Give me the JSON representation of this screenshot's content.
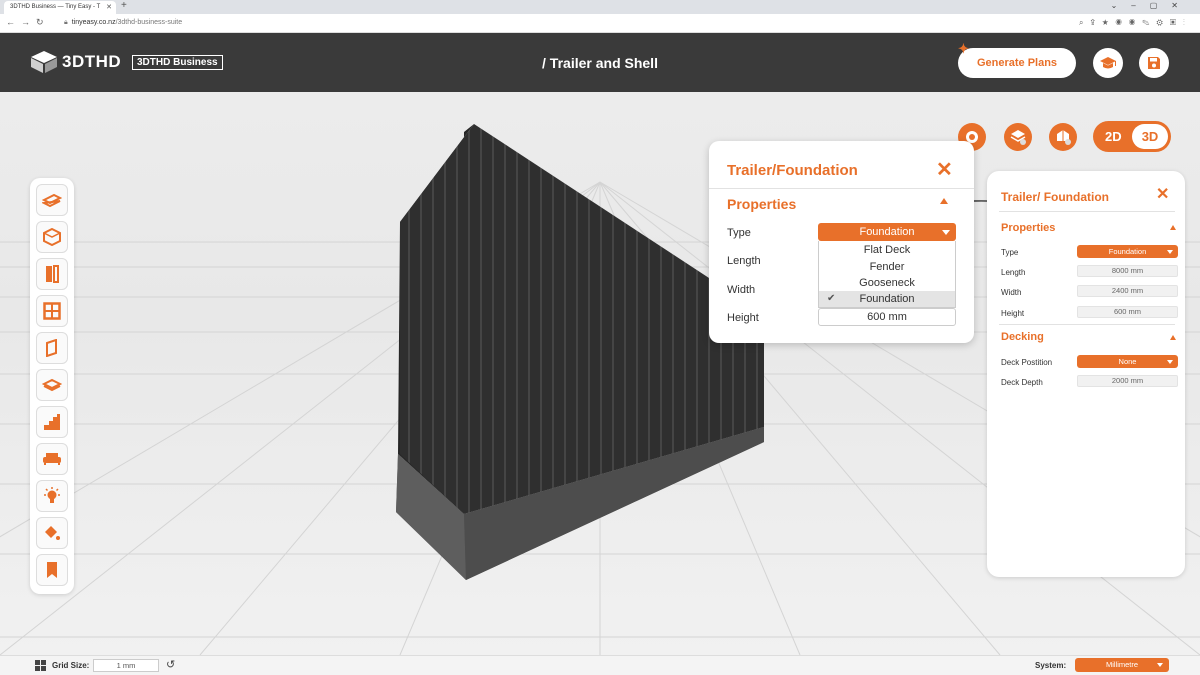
{
  "browser": {
    "tab_title": "3DTHD Business — Tiny Easy - T",
    "url_domain": "tinyeasy.co.nz",
    "url_path": "/3dthd-business-suite"
  },
  "header": {
    "logo_text": "3DTHD",
    "business_badge": "3DTHD Business",
    "page_title": "/ Trailer and Shell",
    "generate_label": "Generate Plans"
  },
  "view": {
    "label_2d": "2D",
    "label_3d": "3D",
    "active": "3D"
  },
  "popup": {
    "title": "Trailer/Foundation",
    "section": "Properties",
    "labels": {
      "type": "Type",
      "length": "Length",
      "width": "Width",
      "height": "Height"
    },
    "type_value": "Foundation",
    "type_options": [
      "Flat Deck",
      "Fender",
      "Gooseneck",
      "Foundation"
    ],
    "selected_option": "Foundation",
    "height_value": "600 mm"
  },
  "panel": {
    "title": "Trailer/ Foundation",
    "properties": {
      "section": "Properties",
      "type_label": "Type",
      "type_value": "Foundation",
      "length_label": "Length",
      "length_value": "8000 mm",
      "width_label": "Width",
      "width_value": "2400 mm",
      "height_label": "Height",
      "height_value": "600 mm"
    },
    "decking": {
      "section": "Decking",
      "position_label": "Deck Postition",
      "position_value": "None",
      "depth_label": "Deck Depth",
      "depth_value": "2000 mm"
    }
  },
  "footer": {
    "grid_label": "Grid Size:",
    "grid_value": "1 mm",
    "system_label": "System:",
    "system_value": "Millimetre"
  },
  "toolbar_icons": [
    "floor-icon",
    "shell-icon",
    "door-icon",
    "window-icon",
    "wall-panel-icon",
    "roof-icon",
    "stairs-icon",
    "sofa-icon",
    "light-icon",
    "paint-icon",
    "bookmark-icon"
  ],
  "colors": {
    "accent": "#e8702a",
    "header": "#3a3a3a",
    "shell": "#2f2f2f",
    "foundation": "#5a5a5a"
  }
}
